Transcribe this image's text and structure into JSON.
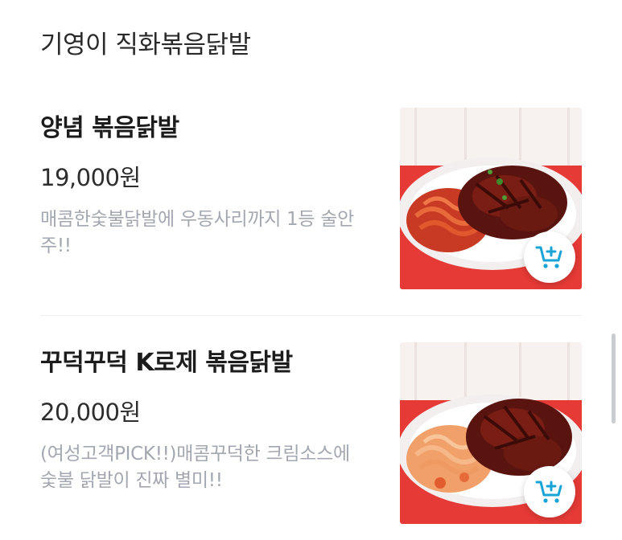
{
  "section": {
    "title": "기영이 직화볶음닭발"
  },
  "items": [
    {
      "name": "양념 볶음닭발",
      "price": "19,000원",
      "description": "매콤한숯불닭발에 우동사리까지 1등 술안주!!",
      "image_icon": "spicy-chicken-feet-with-udon-photo",
      "add_icon": "add-to-cart-icon"
    },
    {
      "name": "꾸덕꾸덕 K로제 볶음닭발",
      "price": "20,000원",
      "description": "(여성고객PICK!!)매콤꾸덕한 크림소스에 숯불 닭발이 진짜 별미!!",
      "image_icon": "rose-sauce-chicken-feet-photo",
      "add_icon": "add-to-cart-icon"
    }
  ],
  "colors": {
    "accent": "#1aa3d6",
    "description_text": "#a3a8b0",
    "photo_background": "#e53a36"
  }
}
